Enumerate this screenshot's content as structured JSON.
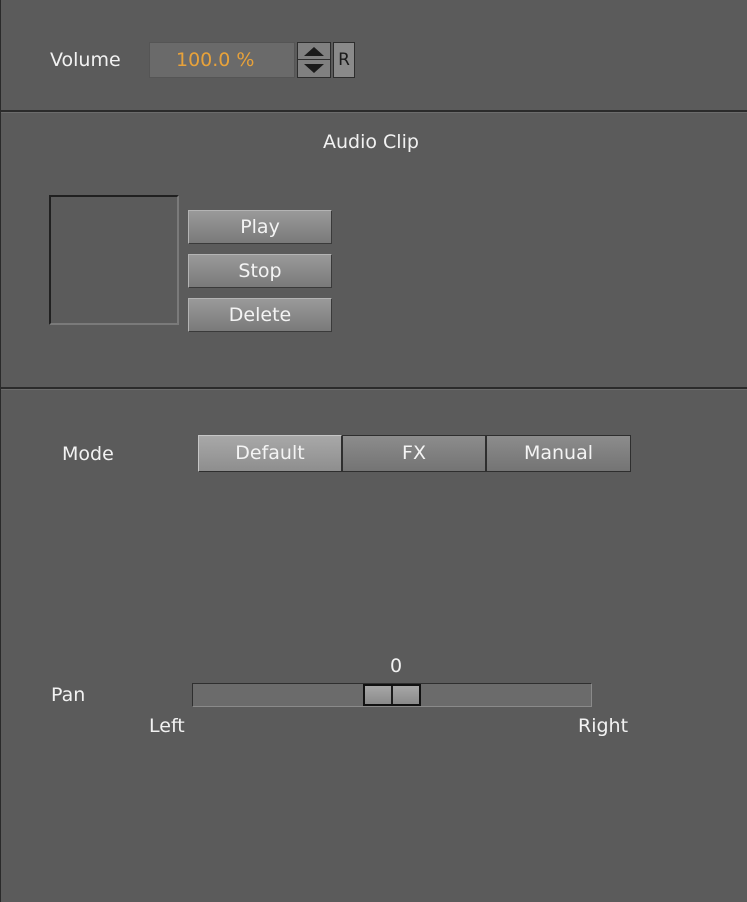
{
  "volume": {
    "label": "Volume",
    "value": "100.0 %",
    "reset_label": "R"
  },
  "audio_clip": {
    "title": "Audio Clip",
    "buttons": {
      "play": "Play",
      "stop": "Stop",
      "delete": "Delete"
    }
  },
  "mode": {
    "label": "Mode",
    "options": [
      "Default",
      "FX",
      "Manual"
    ],
    "selected": "Default"
  },
  "pan": {
    "label": "Pan",
    "value": "0",
    "min_label": "Left",
    "max_label": "Right",
    "position_fraction": 0.5
  },
  "colors": {
    "panel_bg": "#5b5b5b",
    "value_accent": "#e8a23a",
    "text": "#f2f2f2"
  },
  "icons": {
    "spinner_up": "triangle-up",
    "spinner_down": "triangle-down"
  }
}
